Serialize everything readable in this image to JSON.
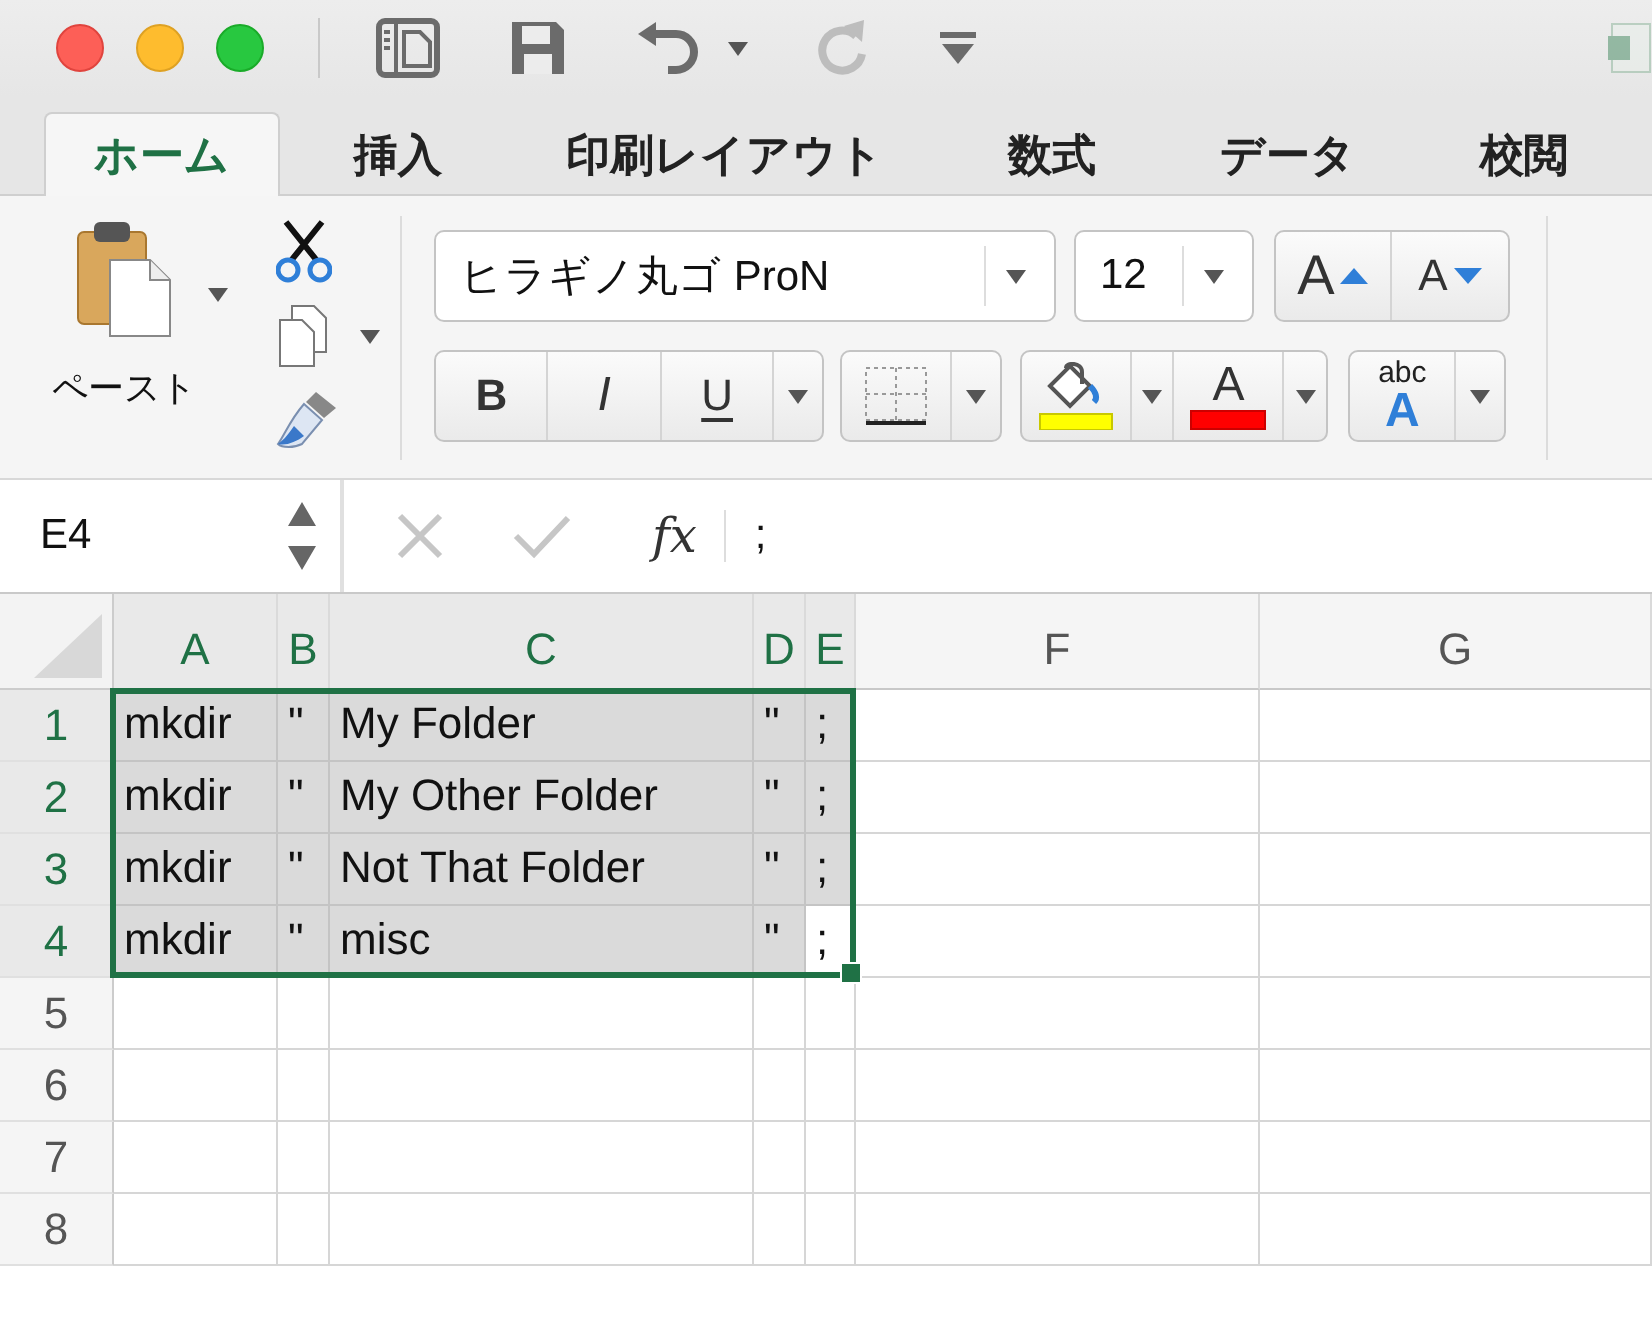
{
  "title_bar": {
    "quick_access": [
      {
        "kind": "sidebar",
        "disabled": false
      },
      {
        "kind": "save",
        "disabled": false
      },
      {
        "kind": "undo",
        "disabled": false
      },
      {
        "kind": "redo",
        "disabled": true
      },
      {
        "kind": "customize",
        "disabled": false
      }
    ]
  },
  "tabs": [
    {
      "label": "ホーム",
      "selected": true
    },
    {
      "label": "挿入",
      "selected": false
    },
    {
      "label": "印刷レイアウト",
      "selected": false
    },
    {
      "label": "数式",
      "selected": false
    },
    {
      "label": "データ",
      "selected": false
    },
    {
      "label": "校閲",
      "selected": false
    }
  ],
  "ribbon": {
    "paste_label": "ペースト",
    "font_name": "ヒラギノ丸ゴ ProN",
    "font_size": "12",
    "grow_font": "A",
    "shrink_font": "A",
    "bold": "B",
    "italic": "I",
    "underline": "U",
    "font_color": "A",
    "orientation": {
      "top": "abc",
      "bottom": "A"
    }
  },
  "formula_bar": {
    "name_box": "E4",
    "function_label": "fx",
    "content": ";"
  },
  "sheet": {
    "columns": [
      {
        "label": "A",
        "selected": true
      },
      {
        "label": "B",
        "selected": true
      },
      {
        "label": "C",
        "selected": true
      },
      {
        "label": "D",
        "selected": true
      },
      {
        "label": "E",
        "selected": true
      },
      {
        "label": "F",
        "selected": false
      },
      {
        "label": "G",
        "selected": false
      }
    ],
    "rows": [
      {
        "label": "1",
        "selected": true,
        "cells": [
          {
            "value": "mkdir",
            "selected": true,
            "active": false
          },
          {
            "value": "\"",
            "selected": true,
            "active": false
          },
          {
            "value": "My Folder",
            "selected": true,
            "active": false
          },
          {
            "value": "\"",
            "selected": true,
            "active": false
          },
          {
            "value": ";",
            "selected": true,
            "active": false
          }
        ]
      },
      {
        "label": "2",
        "selected": true,
        "cells": [
          {
            "value": "mkdir",
            "selected": true,
            "active": false
          },
          {
            "value": "\"",
            "selected": true,
            "active": false
          },
          {
            "value": "My Other Folder",
            "selected": true,
            "active": false
          },
          {
            "value": "\"",
            "selected": true,
            "active": false
          },
          {
            "value": ";",
            "selected": true,
            "active": false
          }
        ]
      },
      {
        "label": "3",
        "selected": true,
        "cells": [
          {
            "value": "mkdir",
            "selected": true,
            "active": false
          },
          {
            "value": "\"",
            "selected": true,
            "active": false
          },
          {
            "value": "Not That Folder",
            "selected": true,
            "active": false
          },
          {
            "value": "\"",
            "selected": true,
            "active": false
          },
          {
            "value": ";",
            "selected": true,
            "active": false
          }
        ]
      },
      {
        "label": "4",
        "selected": true,
        "cells": [
          {
            "value": "mkdir",
            "selected": true,
            "active": false
          },
          {
            "value": "\"",
            "selected": true,
            "active": false
          },
          {
            "value": "misc",
            "selected": true,
            "active": false
          },
          {
            "value": "\"",
            "selected": true,
            "active": false
          },
          {
            "value": ";",
            "selected": true,
            "active": true
          }
        ]
      },
      {
        "label": "5",
        "selected": false
      },
      {
        "label": "6",
        "selected": false
      },
      {
        "label": "7",
        "selected": false
      },
      {
        "label": "8",
        "selected": false
      }
    ]
  }
}
